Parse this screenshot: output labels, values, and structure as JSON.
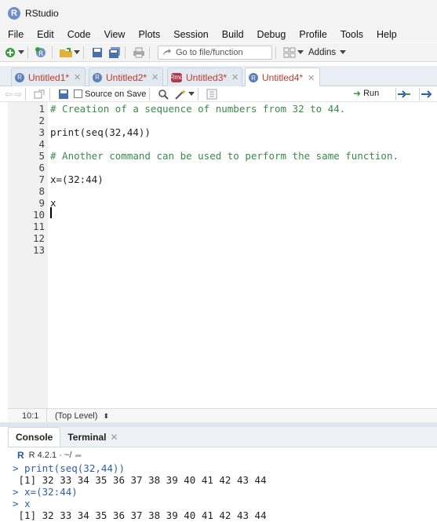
{
  "app": {
    "title": "RStudio"
  },
  "menu": [
    "File",
    "Edit",
    "Code",
    "View",
    "Plots",
    "Session",
    "Build",
    "Debug",
    "Profile",
    "Tools",
    "Help"
  ],
  "toolbar": {
    "goto_placeholder": "Go to file/function",
    "addins_label": "Addins"
  },
  "tabs": [
    {
      "label": "Untitled1*",
      "active": false
    },
    {
      "label": "Untitled2*",
      "active": false
    },
    {
      "label": "Untitled3*",
      "active": false
    },
    {
      "label": "Untitled4*",
      "active": true
    }
  ],
  "editor_toolbar": {
    "source_on_save_label": "Source on Save",
    "source_on_save_checked": false,
    "run_label": "Run"
  },
  "editor": {
    "lines": [
      {
        "no": "1",
        "text": "# Creation of a sequence of numbers from 32 to 44.",
        "type": "comment"
      },
      {
        "no": "2",
        "text": "",
        "type": "code"
      },
      {
        "no": "3",
        "text": "print(seq(32,44))",
        "type": "code"
      },
      {
        "no": "4",
        "text": "",
        "type": "code"
      },
      {
        "no": "5",
        "text": "# Another command can be used to perform the same function.",
        "type": "comment"
      },
      {
        "no": "6",
        "text": "",
        "type": "code"
      },
      {
        "no": "7",
        "text": "x=(32:44)",
        "type": "code"
      },
      {
        "no": "8",
        "text": "",
        "type": "code"
      },
      {
        "no": "9",
        "text": "x",
        "type": "code"
      },
      {
        "no": "10",
        "text": "",
        "type": "code"
      },
      {
        "no": "11",
        "text": "",
        "type": "code"
      },
      {
        "no": "12",
        "text": "",
        "type": "code"
      },
      {
        "no": "13",
        "text": "",
        "type": "code"
      }
    ]
  },
  "status": {
    "position": "10:1",
    "scope": "(Top Level)"
  },
  "console_tabs": [
    {
      "label": "Console",
      "active": true
    },
    {
      "label": "Terminal",
      "active": false
    }
  ],
  "console_header": {
    "r_version": "R 4.2.1 · ~/"
  },
  "console": [
    {
      "text": "> print(seq(32,44))",
      "kind": "in"
    },
    {
      "text": " [1] 32 33 34 35 36 37 38 39 40 41 42 43 44",
      "kind": "out"
    },
    {
      "text": "> x=(32:44)",
      "kind": "in"
    },
    {
      "text": "> x",
      "kind": "in"
    },
    {
      "text": " [1] 32 33 34 35 36 37 38 39 40 41 42 43 44",
      "kind": "out"
    }
  ],
  "colors": {
    "comment": "#3b8a4a",
    "console_input": "#2f5ea8",
    "tab_text": "#c0392b"
  }
}
